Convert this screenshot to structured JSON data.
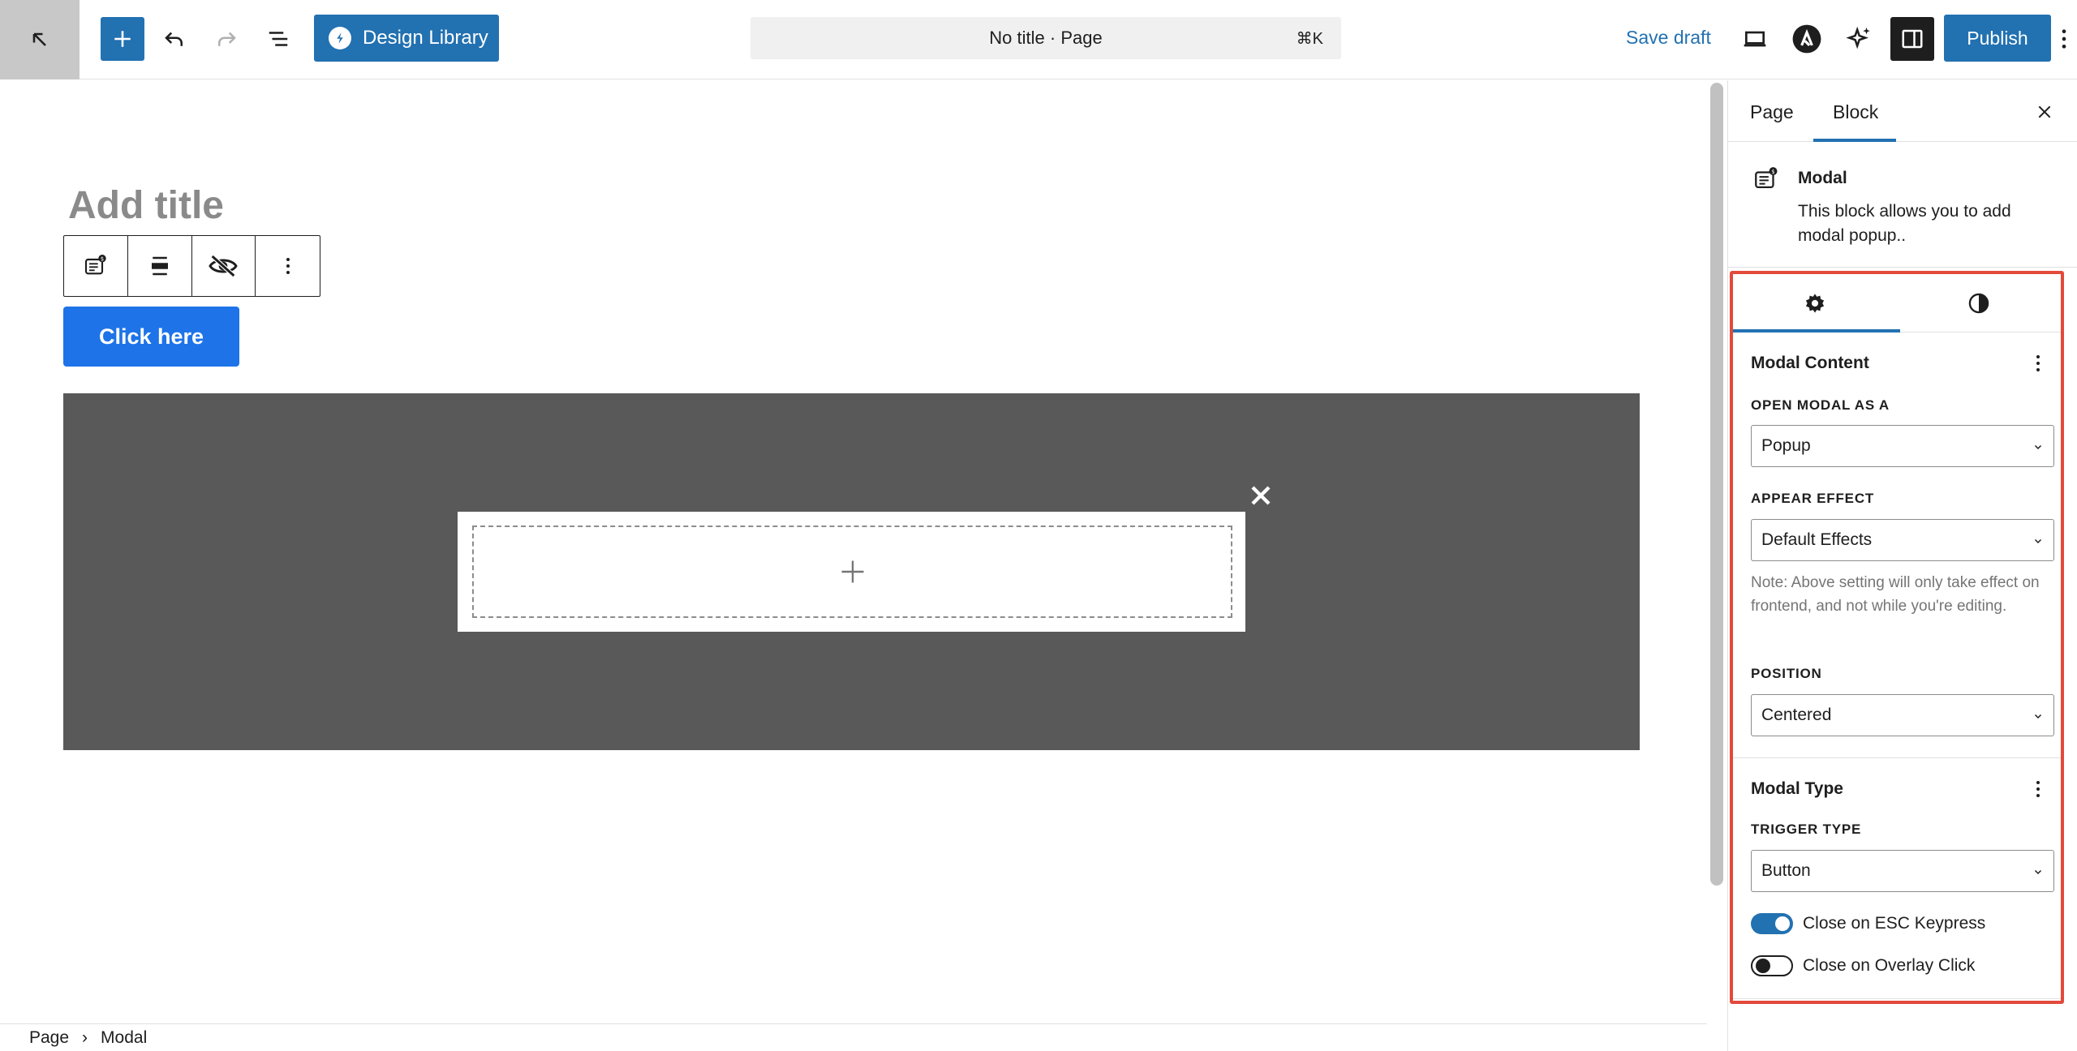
{
  "header": {
    "document_title": "No title · Page",
    "command_shortcut": "⌘K",
    "design_library_label": "Design Library",
    "save_draft_label": "Save draft",
    "publish_label": "Publish"
  },
  "editor": {
    "title_placeholder": "Add title",
    "button_text": "Click here"
  },
  "breadcrumb": {
    "items": [
      "Page",
      "Modal"
    ],
    "separator": "›"
  },
  "sidebar": {
    "tabs": [
      "Page",
      "Block"
    ],
    "active_tab": "Block",
    "block_card": {
      "title": "Modal",
      "description": "This block allows you to add modal popup.."
    },
    "panels": {
      "modal_content": {
        "title": "Modal Content",
        "open_modal_label": "OPEN MODAL AS A",
        "open_modal_value": "Popup",
        "appear_effect_label": "APPEAR EFFECT",
        "appear_effect_value": "Default Effects",
        "note": "Note: Above setting will only take effect on frontend, and not while you're editing.",
        "position_label": "POSITION",
        "position_value": "Centered"
      },
      "modal_type": {
        "title": "Modal Type",
        "trigger_type_label": "TRIGGER TYPE",
        "trigger_type_value": "Button",
        "toggles": [
          {
            "label": "Close on ESC Keypress",
            "checked": true
          },
          {
            "label": "Close on Overlay Click",
            "checked": false
          }
        ]
      }
    }
  },
  "colors": {
    "accent": "#2271b1",
    "button_blue": "#1e73e8",
    "overlay": "#595959",
    "highlight": "#e24a3b"
  }
}
